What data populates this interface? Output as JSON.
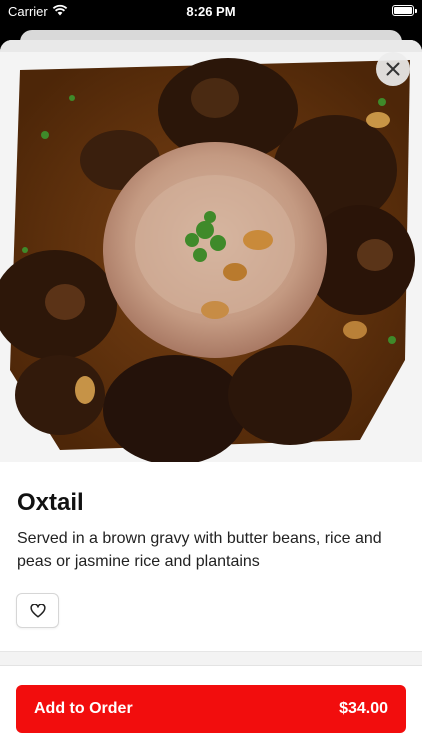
{
  "status_bar": {
    "carrier": "Carrier",
    "time": "8:26 PM"
  },
  "item": {
    "name": "Oxtail",
    "description": "Served in a brown gravy with butter beans, rice and peas or jasmine rice and plantains",
    "image_icon": "oxtail-dish-photo"
  },
  "actions": {
    "close_icon": "close-icon",
    "favorite_icon": "heart-icon",
    "add_label": "Add to Order",
    "price": "$34.00"
  },
  "colors": {
    "primary_red": "#f20d0d",
    "sheet_bg": "#ffffff",
    "gravy": "#6b3a12"
  }
}
